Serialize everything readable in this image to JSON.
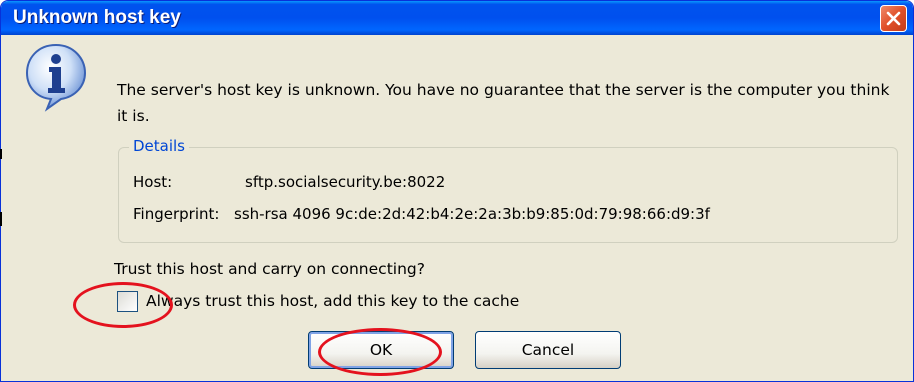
{
  "window": {
    "title": "Unknown host key",
    "close_icon": "close-icon",
    "info_icon": "info-icon"
  },
  "message": "The server's host key is unknown. You have no guarantee that the server is the computer you think it is.",
  "details": {
    "legend": "Details",
    "host_label": "Host:",
    "host_value": "sftp.socialsecurity.be:8022",
    "fingerprint_label": "Fingerprint:",
    "fingerprint_value": "ssh-rsa 4096 9c:de:2d:42:b4:2e:2a:3b:b9:85:0d:79:98:66:d9:3f"
  },
  "prompt": "Trust this host and carry on connecting?",
  "checkbox": {
    "label": "Always trust this host, add this key to the cache",
    "checked": false
  },
  "buttons": {
    "ok": "OK",
    "cancel": "Cancel"
  },
  "colors": {
    "titlebar": "#0053ee",
    "dialog_bg": "#ece9d8",
    "annotation": "#e4121e",
    "legend_text": "#0046d5"
  }
}
